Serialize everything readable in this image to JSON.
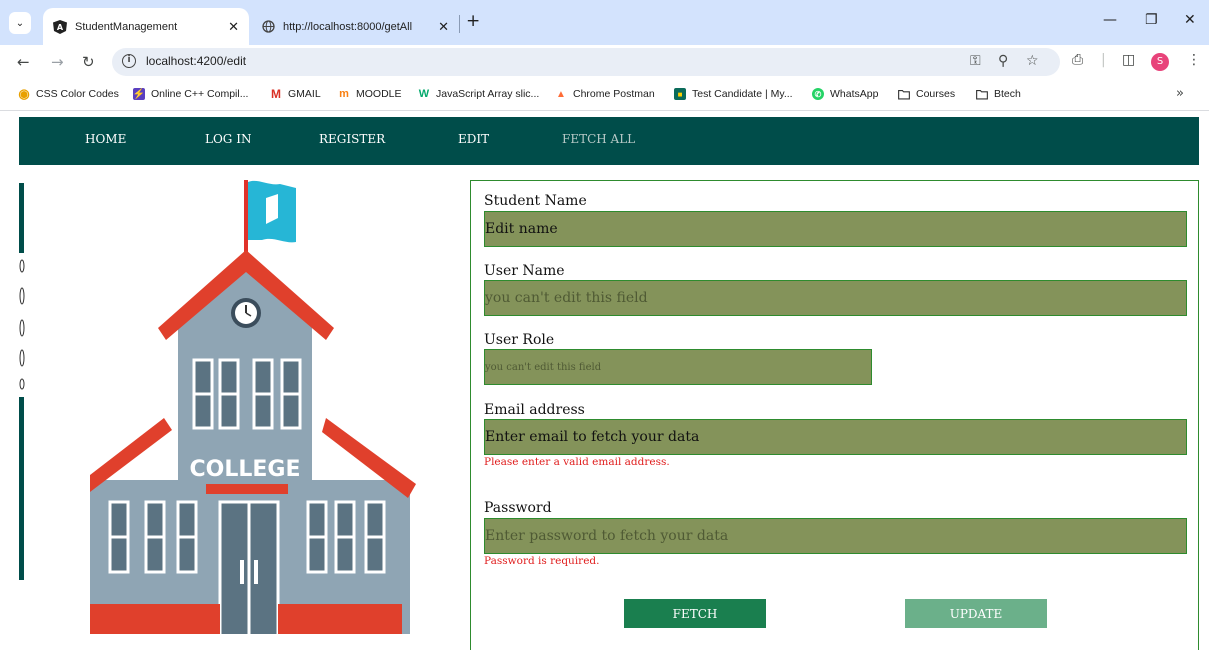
{
  "browser": {
    "tabs": [
      {
        "title": "StudentManagement",
        "active": true
      },
      {
        "title": "http://localhost:8000/getAll",
        "active": false
      }
    ],
    "url": "localhost:4200/edit",
    "profile_initial": "S",
    "bookmarks": [
      {
        "label": "CSS Color Codes",
        "icon": "css-color-icon"
      },
      {
        "label": "Online C++ Compil...",
        "icon": "compiler-icon"
      },
      {
        "label": "GMAIL",
        "icon": "gmail-icon"
      },
      {
        "label": "MOODLE",
        "icon": "moodle-icon"
      },
      {
        "label": "JavaScript Array slic...",
        "icon": "w3schools-icon"
      },
      {
        "label": "Chrome Postman",
        "icon": "postman-icon"
      },
      {
        "label": "Test Candidate | My...",
        "icon": "candidate-icon"
      },
      {
        "label": "WhatsApp",
        "icon": "whatsapp-icon"
      },
      {
        "label": "Courses",
        "icon": "folder-icon"
      },
      {
        "label": "Btech",
        "icon": "folder-icon"
      }
    ]
  },
  "nav": {
    "home": "HOME",
    "login": "LOG IN",
    "register": "REGISTER",
    "edit": "EDIT",
    "fetch_all": "FETCH ALL"
  },
  "illustration": {
    "sign_text": "COLLEGE"
  },
  "form": {
    "student_name": {
      "label": "Student Name",
      "value": "Edit name"
    },
    "user_name": {
      "label": "User Name",
      "placeholder": "you can't edit this field"
    },
    "user_role": {
      "label": "User Role",
      "placeholder": "you can't edit this field"
    },
    "email": {
      "label": "Email address",
      "value": "Enter email to fetch your data",
      "error": "Please enter a valid email address."
    },
    "password": {
      "label": "Password",
      "placeholder": "Enter password to fetch your data",
      "error": "Password is required."
    },
    "fetch_button": "FETCH",
    "update_button": "UPDATE"
  },
  "colors": {
    "nav_bg": "#004d4a",
    "input_bg": "#84935a",
    "fetch_btn": "#1a7f4f",
    "update_btn": "#6bb08a",
    "error": "#e01e1e"
  }
}
